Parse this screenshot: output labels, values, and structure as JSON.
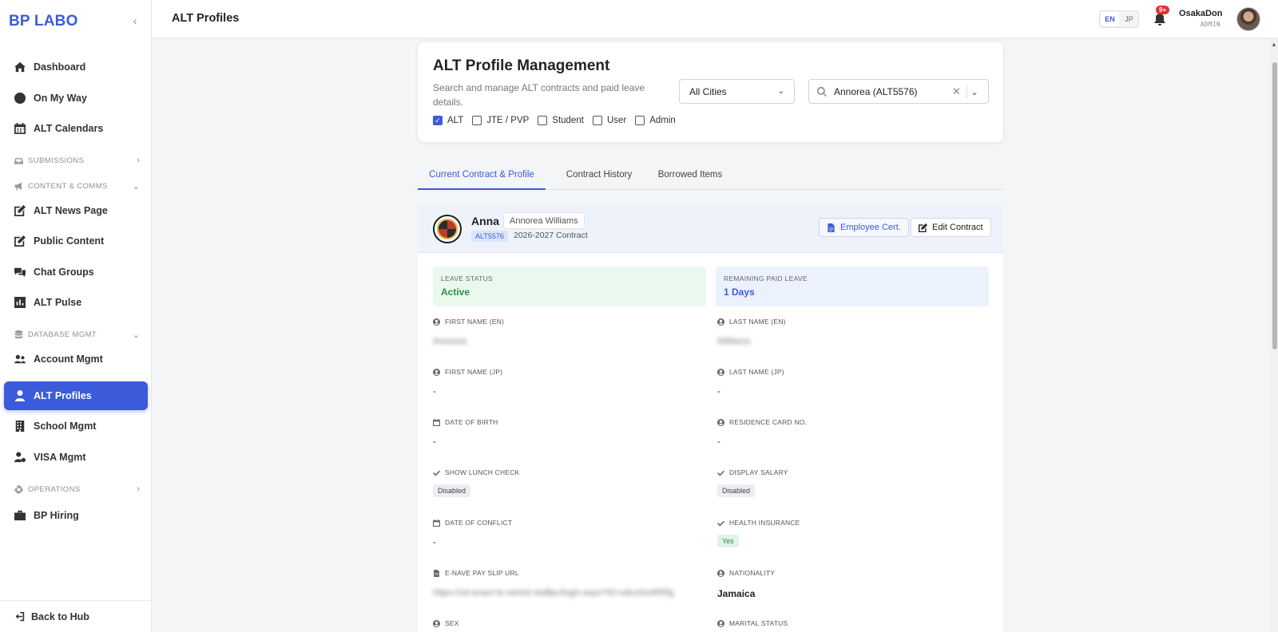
{
  "brand": "BP LABO",
  "colors": {
    "accent": "#3b5bdb",
    "active_status": "#2f8f46",
    "badge": "#e03131"
  },
  "sidebar": {
    "items": [
      {
        "label": "Dashboard",
        "icon": "home-icon"
      },
      {
        "label": "On My Way",
        "icon": "clock-icon"
      },
      {
        "label": "ALT Calendars",
        "icon": "calendar-icon"
      },
      {
        "label": "ALT News Page",
        "icon": "edit-icon"
      },
      {
        "label": "Public Content",
        "icon": "edit-icon"
      },
      {
        "label": "Chat Groups",
        "icon": "chat-icon"
      },
      {
        "label": "ALT Pulse",
        "icon": "chart-icon"
      },
      {
        "label": "Account Mgmt",
        "icon": "users-icon"
      },
      {
        "label": "ALT Profiles",
        "icon": "user-icon"
      },
      {
        "label": "School Mgmt",
        "icon": "building-icon"
      },
      {
        "label": "VISA Mgmt",
        "icon": "user-cog-icon"
      },
      {
        "label": "BP Hiring",
        "icon": "briefcase-icon"
      }
    ],
    "sections": [
      {
        "label": "SUBMISSIONS",
        "icon": "inbox-icon",
        "chevron": "›"
      },
      {
        "label": "CONTENT & COMMS",
        "icon": "megaphone-icon",
        "chevron": "⌄"
      },
      {
        "label": "DATABASE MGMT",
        "icon": "database-icon",
        "chevron": "⌄"
      },
      {
        "label": "OPERATIONS",
        "icon": "cog-icon",
        "chevron": "›"
      }
    ],
    "active": "ALT Profiles",
    "footer": "Back to Hub"
  },
  "header": {
    "title": "ALT Profiles",
    "lang": {
      "en": "EN",
      "jp": "JP",
      "selected": "EN"
    },
    "notifications": "9+",
    "user": {
      "name": "OsakaDon",
      "role": "ADMIN"
    }
  },
  "search_card": {
    "title": "ALT Profile Management",
    "description": "Search and manage ALT contracts and paid leave details.",
    "city_select": "All Cities",
    "search_value": "Annorea (ALT5576)",
    "filters": [
      {
        "label": "ALT",
        "checked": true
      },
      {
        "label": "JTE / PVP",
        "checked": false
      },
      {
        "label": "Student",
        "checked": false
      },
      {
        "label": "User",
        "checked": false
      },
      {
        "label": "Admin",
        "checked": false
      }
    ]
  },
  "tabs": [
    {
      "label": "Current Contract & Profile"
    },
    {
      "label": "Contract History"
    },
    {
      "label": "Borrowed Items"
    }
  ],
  "profile": {
    "name": "Anna",
    "full_name": "Annorea Williams",
    "id": "ALT5576",
    "contract": "2026-2027 Contract",
    "cert_button": "Employee Cert.",
    "edit_button": "Edit Contract",
    "leave_status_label": "LEAVE STATUS",
    "leave_status": "Active",
    "remaining_label": "REMAINING PAID LEAVE",
    "remaining": "1 Days",
    "fields": {
      "first_name_en": {
        "label": "FIRST NAME (EN)",
        "value": "Annorea"
      },
      "last_name_en": {
        "label": "LAST NAME (EN)",
        "value": "Williams"
      },
      "first_name_jp": {
        "label": "FIRST NAME (JP)",
        "value": "-"
      },
      "last_name_jp": {
        "label": "LAST NAME (JP)",
        "value": "-"
      },
      "dob": {
        "label": "DATE OF BIRTH",
        "value": "-"
      },
      "residence": {
        "label": "RESIDENCE CARD NO.",
        "value": "-"
      },
      "lunch": {
        "label": "SHOW LUNCH CHECK",
        "value": "Disabled"
      },
      "salary": {
        "label": "DISPLAY SALARY",
        "value": "Disabled"
      },
      "conflict": {
        "label": "DATE OF CONFLICT",
        "value": "-"
      },
      "health": {
        "label": "HEALTH INSURANCE",
        "value": "Yes"
      },
      "payslip": {
        "label": "E-NAVE PAY SLIP URL",
        "value": "https://ssl.enavi-ts.net/ssl-staffpc/login.aspx?ID=sdLeSo4R5fg"
      },
      "nationality": {
        "label": "NATIONALITY",
        "value": "Jamaica"
      },
      "sex": {
        "label": "SEX"
      },
      "marital": {
        "label": "MARITAL STATUS"
      }
    }
  }
}
